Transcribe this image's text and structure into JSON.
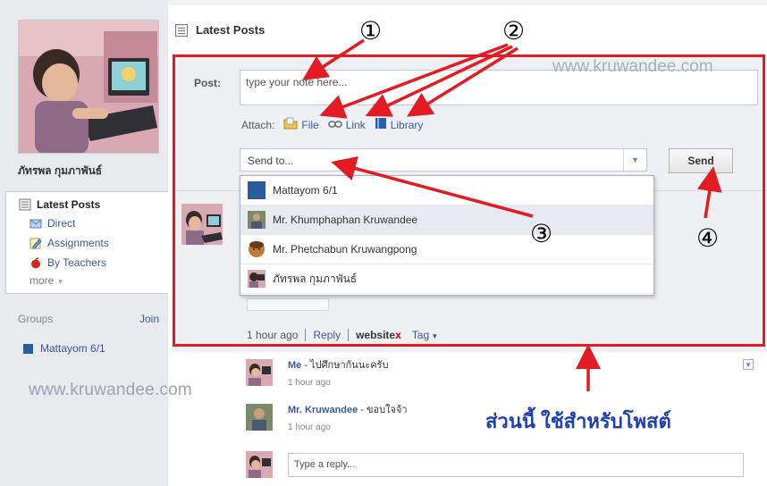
{
  "sidebar": {
    "profile_name": "ภัทรพล กุมภาพันธ์",
    "nav": {
      "latest_posts": "Latest Posts",
      "direct": "Direct",
      "assignments": "Assignments",
      "by_teachers": "By Teachers",
      "more": "more"
    },
    "groups": {
      "label": "Groups",
      "join": "Join",
      "items": [
        "Mattayom 6/1"
      ]
    },
    "watermark": "www.kruwandee.com"
  },
  "main": {
    "header_title": "Latest Posts",
    "composer": {
      "post_label": "Post:",
      "post_placeholder": "type your note here...",
      "attach_label": "Attach:",
      "attach_file": "File",
      "attach_link": "Link",
      "attach_library": "Library",
      "sendto_placeholder": "Send to...",
      "send_button": "Send"
    },
    "dropdown": [
      "Mattayom 6/1",
      "Mr. Khumphaphan Kruwandee",
      "Mr. Phetchabun Kruwangpong",
      "ภัทรพล กุมภาพันธ์"
    ],
    "post_meta": {
      "time": "1 hour ago",
      "reply": "Reply",
      "tag_chip": "website",
      "tag_remove": "x",
      "tag_menu": "Tag"
    },
    "comments": [
      {
        "author": "Me",
        "text": " - ไปศึกษากันนะครับ",
        "time": "1 hour ago"
      },
      {
        "author": "Mr. Kruwandee",
        "text": " - ขอบใจจ้า",
        "time": "1 hour ago"
      }
    ],
    "reply_placeholder": "Type a reply..."
  },
  "annotations": {
    "watermark": "www.kruwandee.com",
    "n1": "①",
    "n2": "②",
    "n3": "③",
    "n4": "④",
    "caption": "ส่วนนี้ ใช้สำหรับโพสต์",
    "frame_color": "#e31c23"
  }
}
